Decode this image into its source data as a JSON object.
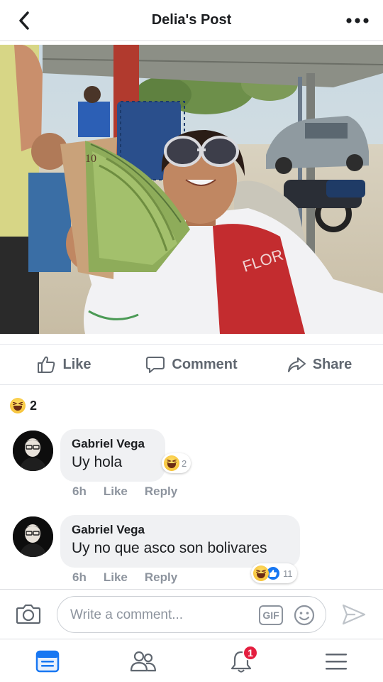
{
  "header": {
    "title": "Delia's Post",
    "back_icon": "chevron-left-icon",
    "more_icon": "ellipsis-icon"
  },
  "post": {
    "photo": "photo of a woman in sunglasses holding a fan of banknotes",
    "banknote_digits": "10"
  },
  "actions": {
    "like": "Like",
    "comment": "Comment",
    "share": "Share"
  },
  "reactions": {
    "type": "haha",
    "count": "2"
  },
  "comments": [
    {
      "author": "Gabriel Vega",
      "text": "Uy hola",
      "time": "6h",
      "like_label": "Like",
      "reply_label": "Reply",
      "reaction_count": "2",
      "reaction_types": [
        "haha"
      ]
    },
    {
      "author": "Gabriel Vega",
      "text": "Uy no que asco son bolivares",
      "time": "6h",
      "like_label": "Like",
      "reply_label": "Reply",
      "reaction_count": "11",
      "reaction_types": [
        "haha",
        "like"
      ]
    }
  ],
  "composer": {
    "placeholder": "Write a comment...",
    "gif_label": "GIF"
  },
  "bottom_nav": {
    "items": [
      "news-feed-icon",
      "friends-icon",
      "notifications-icon",
      "menu-icon"
    ],
    "notifications_badge": "1"
  },
  "colors": {
    "brand_blue": "#1877f2",
    "text_gray": "#606770",
    "meta_gray": "#8d949e",
    "badge_red": "#e41e3f",
    "bubble_bg": "#f0f1f3"
  }
}
